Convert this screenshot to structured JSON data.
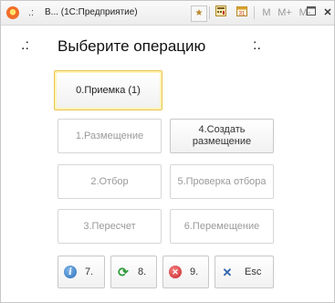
{
  "titlebar": {
    "dots": ".:",
    "title": "В... (1С:Предприятие)",
    "icons": [
      "favorites-icon",
      "calculator-icon",
      "calendar-icon"
    ],
    "memory_buttons": [
      "M",
      "M+",
      "M-"
    ]
  },
  "header": {
    "left_marker": ".:",
    "title": "Выберите операцию",
    "right_marker": ":."
  },
  "buttons": {
    "b0": "0.Приемка (1)",
    "b1": "1.Размещение",
    "b2": "2.Отбор",
    "b3": "3.Пересчет",
    "b4": "4.Создать размещение",
    "b5": "5.Проверка отбора",
    "b6": "6.Перемещение",
    "b7": "7.",
    "b8": "8.",
    "b9": "9.",
    "esc": "Esc"
  },
  "colors": {
    "focus_border": "#e8c44d",
    "info_icon": "#2e6fb8",
    "refresh_icon": "#2d9a3a",
    "stop_icon": "#c8262a",
    "close_icon": "#2f63ad"
  }
}
